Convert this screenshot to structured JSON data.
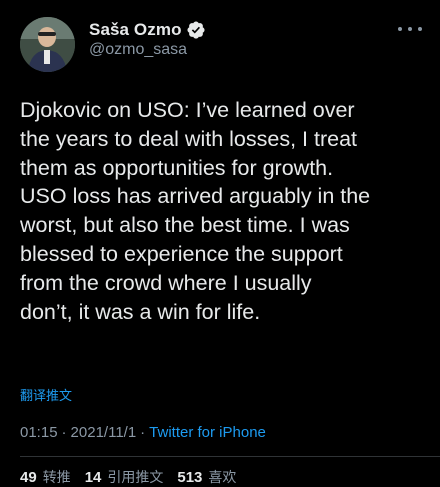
{
  "tweet": {
    "author": {
      "display_name": "Saša Ozmo",
      "handle": "@ozmo_sasa",
      "verified": true
    },
    "text": "Djokovic on USO: I’ve learned over\nthe years to deal with losses, I treat\nthem as opportunities for growth.\nUSO loss has arrived arguably in the\nworst, but also the best time. I was\nblessed to experience the support\nfrom the crowd where I usually\ndon’t, it was a win for life.",
    "translate_label": "翻译推文",
    "time": "01:15",
    "separator": "·",
    "date": "2021/11/1",
    "source": "Twitter for iPhone",
    "stats": [
      {
        "count": "49",
        "label": "转推"
      },
      {
        "count": "14",
        "label": "引用推文"
      },
      {
        "count": "513",
        "label": "喜欢"
      }
    ]
  },
  "colors": {
    "background": "#000000",
    "text": "#e7e9ea",
    "secondary": "#8b98a5",
    "accent": "#1d9bf0"
  },
  "icons": {
    "verified": "verified-badge-icon",
    "more": "more-horizontal-icon"
  }
}
